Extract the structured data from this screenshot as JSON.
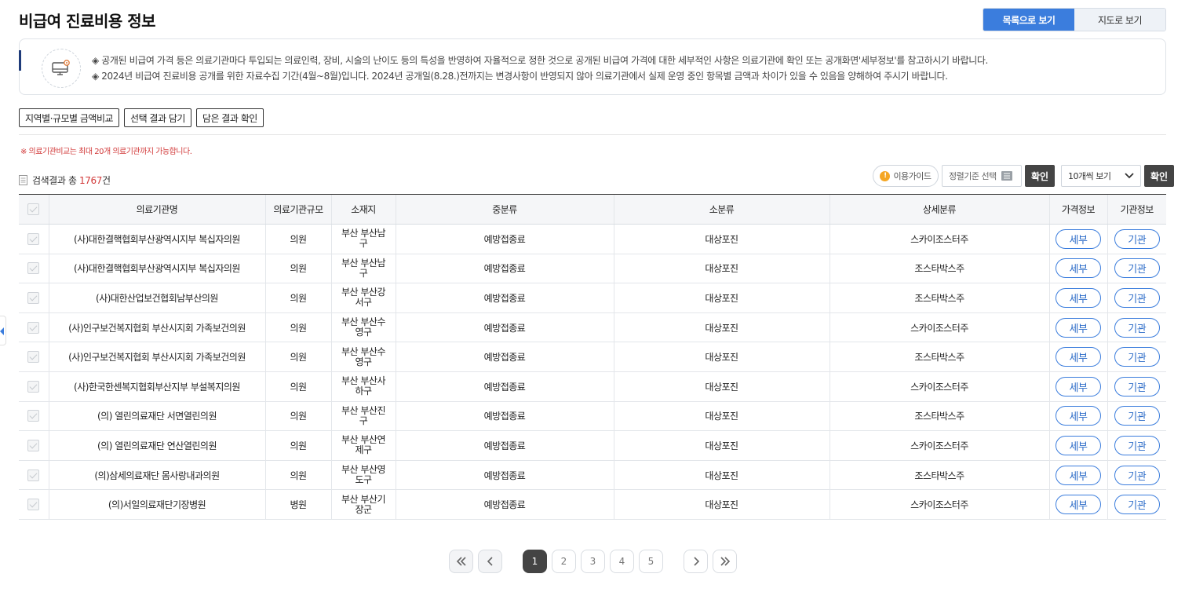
{
  "page": {
    "title": "비급여 진료비용 정보"
  },
  "view_toggle": {
    "list_label": "목록으로 보기",
    "map_label": "지도로 보기"
  },
  "notice": {
    "line1": "◈ 공개된 비급여 가격 등은 의료기관마다 투입되는 의료인력, 장비, 시술의 난이도 등의 특성을 반영하여 자율적으로 정한 것으로 공개된 비급여 가격에 대한 세부적인 사항은 의료기관에 확인 또는 공개화면'세부정보'를 참고하시기 바랍니다.",
    "line2": "◈ 2024년 비급여 진료비용 공개를 위한 자료수집 기간(4월~8월)입니다. 2024년 공개일(8.28.)전까지는 변경사항이 반영되지 않아 의료기관에서 실제 운영 중인 항목별 금액과 차이가 있을 수 있음을 양해하여 주시기 바랍니다."
  },
  "actions": {
    "compare": "지역별·규모별 금액비교",
    "add_selection": "선택 결과 담기",
    "view_saved": "담은 결과 확인"
  },
  "warning": "※ 의료기관비교는 최대 20개 의료기관까지 가능합니다.",
  "result": {
    "prefix": "검색결과 총",
    "count": "1767",
    "suffix": "건"
  },
  "tools": {
    "guide": "이용가이드",
    "sort_placeholder": "정렬기준 선택",
    "confirm": "확인",
    "page_size": "10개씩 보기",
    "confirm2": "확인"
  },
  "table": {
    "headers": [
      "의료기관명",
      "의료기관규모",
      "소재지",
      "중분류",
      "소분류",
      "상세분류",
      "가격정보",
      "기관정보"
    ],
    "rows": [
      {
        "name": "(사)대한결핵협회부산광역시지부 복십자의원",
        "size": "의원",
        "loc1": "부산 부산남",
        "loc2": "구",
        "mid": "예방접종료",
        "small": "대상포진",
        "detail": "스카이조스터주",
        "price": "세부",
        "inst": "기관"
      },
      {
        "name": "(사)대한결핵협회부산광역시지부 복십자의원",
        "size": "의원",
        "loc1": "부산 부산남",
        "loc2": "구",
        "mid": "예방접종료",
        "small": "대상포진",
        "detail": "조스타박스주",
        "price": "세부",
        "inst": "기관"
      },
      {
        "name": "(사)대한산업보건협회남부산의원",
        "size": "의원",
        "loc1": "부산 부산강",
        "loc2": "서구",
        "mid": "예방접종료",
        "small": "대상포진",
        "detail": "조스타박스주",
        "price": "세부",
        "inst": "기관"
      },
      {
        "name": "(사)인구보건복지협회 부산시지회 가족보건의원",
        "size": "의원",
        "loc1": "부산 부산수",
        "loc2": "영구",
        "mid": "예방접종료",
        "small": "대상포진",
        "detail": "스카이조스터주",
        "price": "세부",
        "inst": "기관"
      },
      {
        "name": "(사)인구보건복지협회 부산시지회 가족보건의원",
        "size": "의원",
        "loc1": "부산 부산수",
        "loc2": "영구",
        "mid": "예방접종료",
        "small": "대상포진",
        "detail": "조스타박스주",
        "price": "세부",
        "inst": "기관"
      },
      {
        "name": "(사)한국한센복지협회부산지부 부설복지의원",
        "size": "의원",
        "loc1": "부산 부산사",
        "loc2": "하구",
        "mid": "예방접종료",
        "small": "대상포진",
        "detail": "스카이조스터주",
        "price": "세부",
        "inst": "기관"
      },
      {
        "name": "(의) 열린의료재단 서면열린의원",
        "size": "의원",
        "loc1": "부산 부산진",
        "loc2": "구",
        "mid": "예방접종료",
        "small": "대상포진",
        "detail": "조스타박스주",
        "price": "세부",
        "inst": "기관"
      },
      {
        "name": "(의) 열린의료재단 연산열린의원",
        "size": "의원",
        "loc1": "부산 부산연",
        "loc2": "제구",
        "mid": "예방접종료",
        "small": "대상포진",
        "detail": "스카이조스터주",
        "price": "세부",
        "inst": "기관"
      },
      {
        "name": "(의)삼세의료재단 몸사랑내과의원",
        "size": "의원",
        "loc1": "부산 부산영",
        "loc2": "도구",
        "mid": "예방접종료",
        "small": "대상포진",
        "detail": "조스타박스주",
        "price": "세부",
        "inst": "기관"
      },
      {
        "name": "(의)서일의료재단기장병원",
        "size": "병원",
        "loc1": "부산 부산기",
        "loc2": "장군",
        "mid": "예방접종료",
        "small": "대상포진",
        "detail": "스카이조스터주",
        "price": "세부",
        "inst": "기관"
      }
    ]
  },
  "pagination": {
    "pages": [
      "1",
      "2",
      "3",
      "4",
      "5"
    ],
    "active": "1"
  },
  "colors": {
    "accent": "#3b7ddd",
    "warning": "#d23a3a",
    "dark_button": "#444444"
  },
  "icons": {
    "notice": "monitor-settings-icon",
    "guide": "info-icon",
    "sort": "list-icon",
    "select": "chevron-down-icon"
  }
}
